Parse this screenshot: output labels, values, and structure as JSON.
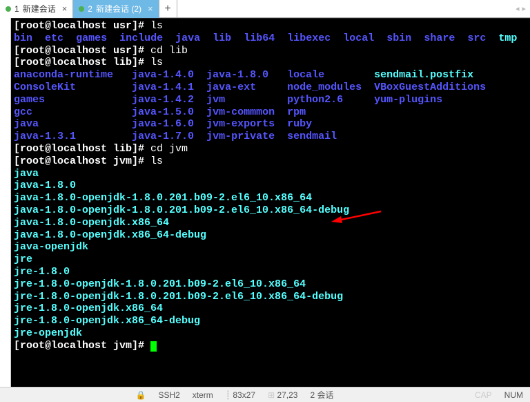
{
  "tabs": {
    "t1": {
      "index": "1",
      "label": "新建会话"
    },
    "t2": {
      "index": "2",
      "label": "新建会话 (2)"
    }
  },
  "prompts": {
    "usr": "[root@localhost usr]# ",
    "lib": "[root@localhost lib]# ",
    "jvm": "[root@localhost jvm]# "
  },
  "cmds": {
    "ls": "ls",
    "cdlib": "cd lib",
    "cdjvm": "cd jvm"
  },
  "ls_usr": {
    "bin": "bin",
    "etc": "etc",
    "games": "games",
    "include": "include",
    "java": "java",
    "lib": "lib",
    "lib64": "lib64",
    "libexec": "libexec",
    "local": "local",
    "sbin": "sbin",
    "share": "share",
    "src": "src",
    "tmp": "tmp"
  },
  "ls_lib": {
    "r1c1": "anaconda-runtime",
    "r1c2": "java-1.4.0",
    "r1c3": "java-1.8.0",
    "r1c4": "locale",
    "r1c5": "sendmail.postfix",
    "r2c1": "ConsoleKit",
    "r2c2": "java-1.4.1",
    "r2c3": "java-ext",
    "r2c4": "node_modules",
    "r2c5": "VBoxGuestAdditions",
    "r3c1": "games",
    "r3c2": "java-1.4.2",
    "r3c3": "jvm",
    "r3c4": "python2.6",
    "r3c5": "yum-plugins",
    "r4c1": "gcc",
    "r4c2": "java-1.5.0",
    "r4c3": "jvm-commmon",
    "r4c4": "rpm",
    "r5c1": "java",
    "r5c2": "java-1.6.0",
    "r5c3": "jvm-exports",
    "r5c4": "ruby",
    "r6c1": "java-1.3.1",
    "r6c2": "java-1.7.0",
    "r6c3": "jvm-private",
    "r6c4": "sendmail"
  },
  "ls_jvm": {
    "l1": "java",
    "l2": "java-1.8.0",
    "l3": "java-1.8.0-openjdk-1.8.0.201.b09-2.el6_10.x86_64",
    "l4": "java-1.8.0-openjdk-1.8.0.201.b09-2.el6_10.x86_64-debug",
    "l5": "java-1.8.0-openjdk.x86_64",
    "l6": "java-1.8.0-openjdk.x86_64-debug",
    "l7": "java-openjdk",
    "l8": "jre",
    "l9": "jre-1.8.0",
    "l10": "jre-1.8.0-openjdk-1.8.0.201.b09-2.el6_10.x86_64",
    "l11": "jre-1.8.0-openjdk-1.8.0.201.b09-2.el6_10.x86_64-debug",
    "l12": "jre-1.8.0-openjdk.x86_64",
    "l13": "jre-1.8.0-openjdk.x86_64-debug",
    "l14": "jre-openjdk"
  },
  "status": {
    "proto": "SSH2",
    "term": "xterm",
    "size": "83x27",
    "pos": "27,23",
    "sess": "2 会话",
    "cap": "CAP",
    "num": "NUM"
  }
}
